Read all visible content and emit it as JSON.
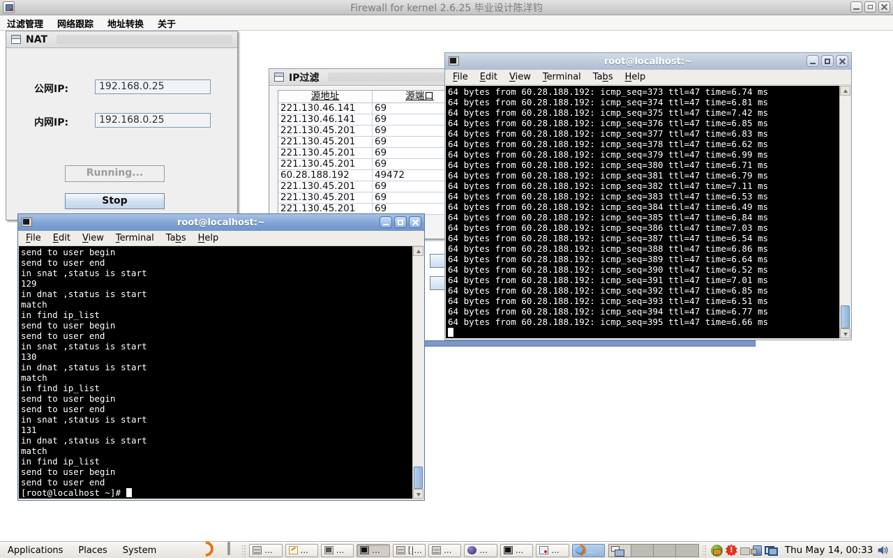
{
  "main_window": {
    "title": "Firewall for kernel 2.6.25 毕业设计陈洋钧",
    "menu_items": [
      "过滤管理",
      "网络跟踪",
      "地址转换",
      "关于"
    ]
  },
  "nat_frame": {
    "title": "NAT",
    "public_ip_label": "公网IP:",
    "public_ip_value": "192.168.0.25",
    "private_ip_label": "内网IP:",
    "private_ip_value": "192.168.0.25",
    "running_button": "Running...",
    "stop_button": "Stop"
  },
  "ipfilter_frame": {
    "title": "IP过滤",
    "columns": [
      "源地址",
      "源端口"
    ],
    "rows": [
      [
        "221.130.46.141",
        "69"
      ],
      [
        "221.130.46.141",
        "69"
      ],
      [
        "221.130.45.201",
        "69"
      ],
      [
        "221.130.45.201",
        "69"
      ],
      [
        "221.130.45.201",
        "69"
      ],
      [
        "221.130.45.201",
        "69"
      ],
      [
        "60.28.188.192",
        "49472"
      ],
      [
        "221.130.45.201",
        "69"
      ],
      [
        "221.130.45.201",
        "69"
      ],
      [
        "221.130.45.201",
        "69"
      ]
    ]
  },
  "terminal_menus": [
    {
      "pre": "",
      "u": "F",
      "post": "ile"
    },
    {
      "pre": "",
      "u": "E",
      "post": "dit"
    },
    {
      "pre": "",
      "u": "V",
      "post": "iew"
    },
    {
      "pre": "",
      "u": "T",
      "post": "erminal"
    },
    {
      "pre": "Ta",
      "u": "b",
      "post": "s"
    },
    {
      "pre": "",
      "u": "H",
      "post": "elp"
    }
  ],
  "terminal_left": {
    "title": "root@localhost:~",
    "lines": [
      "send to user begin",
      "send to user end",
      "in snat ,status is start",
      "129",
      "in dnat ,status is start",
      "match",
      "in find ip_list",
      "send to user begin",
      "send to user end",
      "in snat ,status is start",
      "130",
      "in dnat ,status is start",
      "match",
      "in find ip_list",
      "send to user begin",
      "send to user end",
      "in snat ,status is start",
      "131",
      "in dnat ,status is start",
      "match",
      "in find ip_list",
      "send to user begin",
      "send to user end"
    ],
    "prompt": "[root@localhost ~]# "
  },
  "terminal_right": {
    "title": "root@localhost:~",
    "lines": [
      "64 bytes from 60.28.188.192: icmp_seq=373 ttl=47 time=6.74 ms",
      "64 bytes from 60.28.188.192: icmp_seq=374 ttl=47 time=6.81 ms",
      "64 bytes from 60.28.188.192: icmp_seq=375 ttl=47 time=7.42 ms",
      "64 bytes from 60.28.188.192: icmp_seq=376 ttl=47 time=6.85 ms",
      "64 bytes from 60.28.188.192: icmp_seq=377 ttl=47 time=6.83 ms",
      "64 bytes from 60.28.188.192: icmp_seq=378 ttl=47 time=6.62 ms",
      "64 bytes from 60.28.188.192: icmp_seq=379 ttl=47 time=6.99 ms",
      "64 bytes from 60.28.188.192: icmp_seq=380 ttl=47 time=6.71 ms",
      "64 bytes from 60.28.188.192: icmp_seq=381 ttl=47 time=6.79 ms",
      "64 bytes from 60.28.188.192: icmp_seq=382 ttl=47 time=7.11 ms",
      "64 bytes from 60.28.188.192: icmp_seq=383 ttl=47 time=6.53 ms",
      "64 bytes from 60.28.188.192: icmp_seq=384 ttl=47 time=6.49 ms",
      "64 bytes from 60.28.188.192: icmp_seq=385 ttl=47 time=6.84 ms",
      "64 bytes from 60.28.188.192: icmp_seq=386 ttl=47 time=7.03 ms",
      "64 bytes from 60.28.188.192: icmp_seq=387 ttl=47 time=6.54 ms",
      "64 bytes from 60.28.188.192: icmp_seq=388 ttl=47 time=6.86 ms",
      "64 bytes from 60.28.188.192: icmp_seq=389 ttl=47 time=6.64 ms",
      "64 bytes from 60.28.188.192: icmp_seq=390 ttl=47 time=6.52 ms",
      "64 bytes from 60.28.188.192: icmp_seq=391 ttl=47 time=7.01 ms",
      "64 bytes from 60.28.188.192: icmp_seq=392 ttl=47 time=6.85 ms",
      "64 bytes from 60.28.188.192: icmp_seq=393 ttl=47 time=6.51 ms",
      "64 bytes from 60.28.188.192: icmp_seq=394 ttl=47 time=6.77 ms",
      "64 bytes from 60.28.188.192: icmp_seq=395 ttl=47 time=6.66 ms"
    ]
  },
  "taskbar": {
    "menus": [
      "Applications",
      "Places",
      "System"
    ],
    "launcher_icons": [
      "firefox-launcher-icon",
      "terminal-launcher-icon"
    ],
    "window_buttons": [
      {
        "icon": "file-manager-icon",
        "label": "..."
      },
      {
        "icon": "text-editor-icon",
        "label": "..."
      },
      {
        "icon": "terminal-icon",
        "label": "..."
      },
      {
        "icon": "terminal-icon",
        "label": "..."
      },
      {
        "icon": "file-manager-icon",
        "label": "[|..."
      },
      {
        "icon": "file-manager-icon",
        "label": "..."
      },
      {
        "icon": "eclipse-icon",
        "label": "..."
      },
      {
        "icon": "terminal-icon",
        "label": "..."
      },
      {
        "icon": "java-app-icon",
        "label": "..."
      },
      {
        "icon": "firefox-icon",
        "label": "..."
      }
    ],
    "workspace_count": 4,
    "tray_icons": [
      "software-updater-icon",
      "selinux-alert-icon",
      "input-indicator-icon",
      "network-device-icon",
      "network-computers-icon"
    ],
    "clock": "Thu May 14, 00:33",
    "volume_icon": "volume-icon"
  },
  "colors": {
    "active_titlebar": "#7fa3d4",
    "inactive_titlebar": "#b7c3d6",
    "terminal_bg": "#000000",
    "terminal_fg": "#ffffff",
    "frame_bg": "#efefef",
    "taskbar_bg": "#ebe7e0",
    "stop_button_face": "#cfe0f0"
  }
}
